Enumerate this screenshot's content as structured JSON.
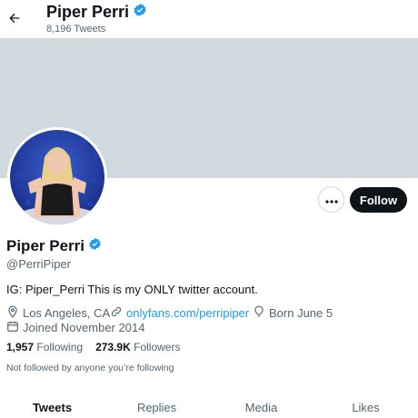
{
  "header": {
    "name": "Piper Perri",
    "tweet_count": "8,196 Tweets"
  },
  "profile": {
    "display_name": "Piper Perri",
    "handle": "@PerriPiper",
    "bio": "IG: Piper_Perri This is my ONLY twitter account.",
    "location": "Los Angeles, CA",
    "website": "onlyfans.com/perripiper",
    "birthday": "Born June 5",
    "joined": "Joined November 2014",
    "following_count": "1,957",
    "following_label": "Following",
    "followers_count": "273.9K",
    "followers_label": "Followers",
    "not_followed_text": "Not followed by anyone you’re following"
  },
  "actions": {
    "follow_label": "Follow"
  },
  "tabs": [
    {
      "label": "Tweets",
      "active": true
    },
    {
      "label": "Replies",
      "active": false
    },
    {
      "label": "Media",
      "active": false
    },
    {
      "label": "Likes",
      "active": false
    }
  ],
  "colors": {
    "accent": "#1d9bf0",
    "banner": "#cfd9de",
    "primary_text": "#0f1419",
    "secondary_text": "#536471"
  },
  "icons": [
    "back-arrow-icon",
    "verified-badge-icon",
    "more-options-icon",
    "location-pin-icon",
    "link-icon",
    "birthday-balloon-icon",
    "calendar-icon"
  ]
}
